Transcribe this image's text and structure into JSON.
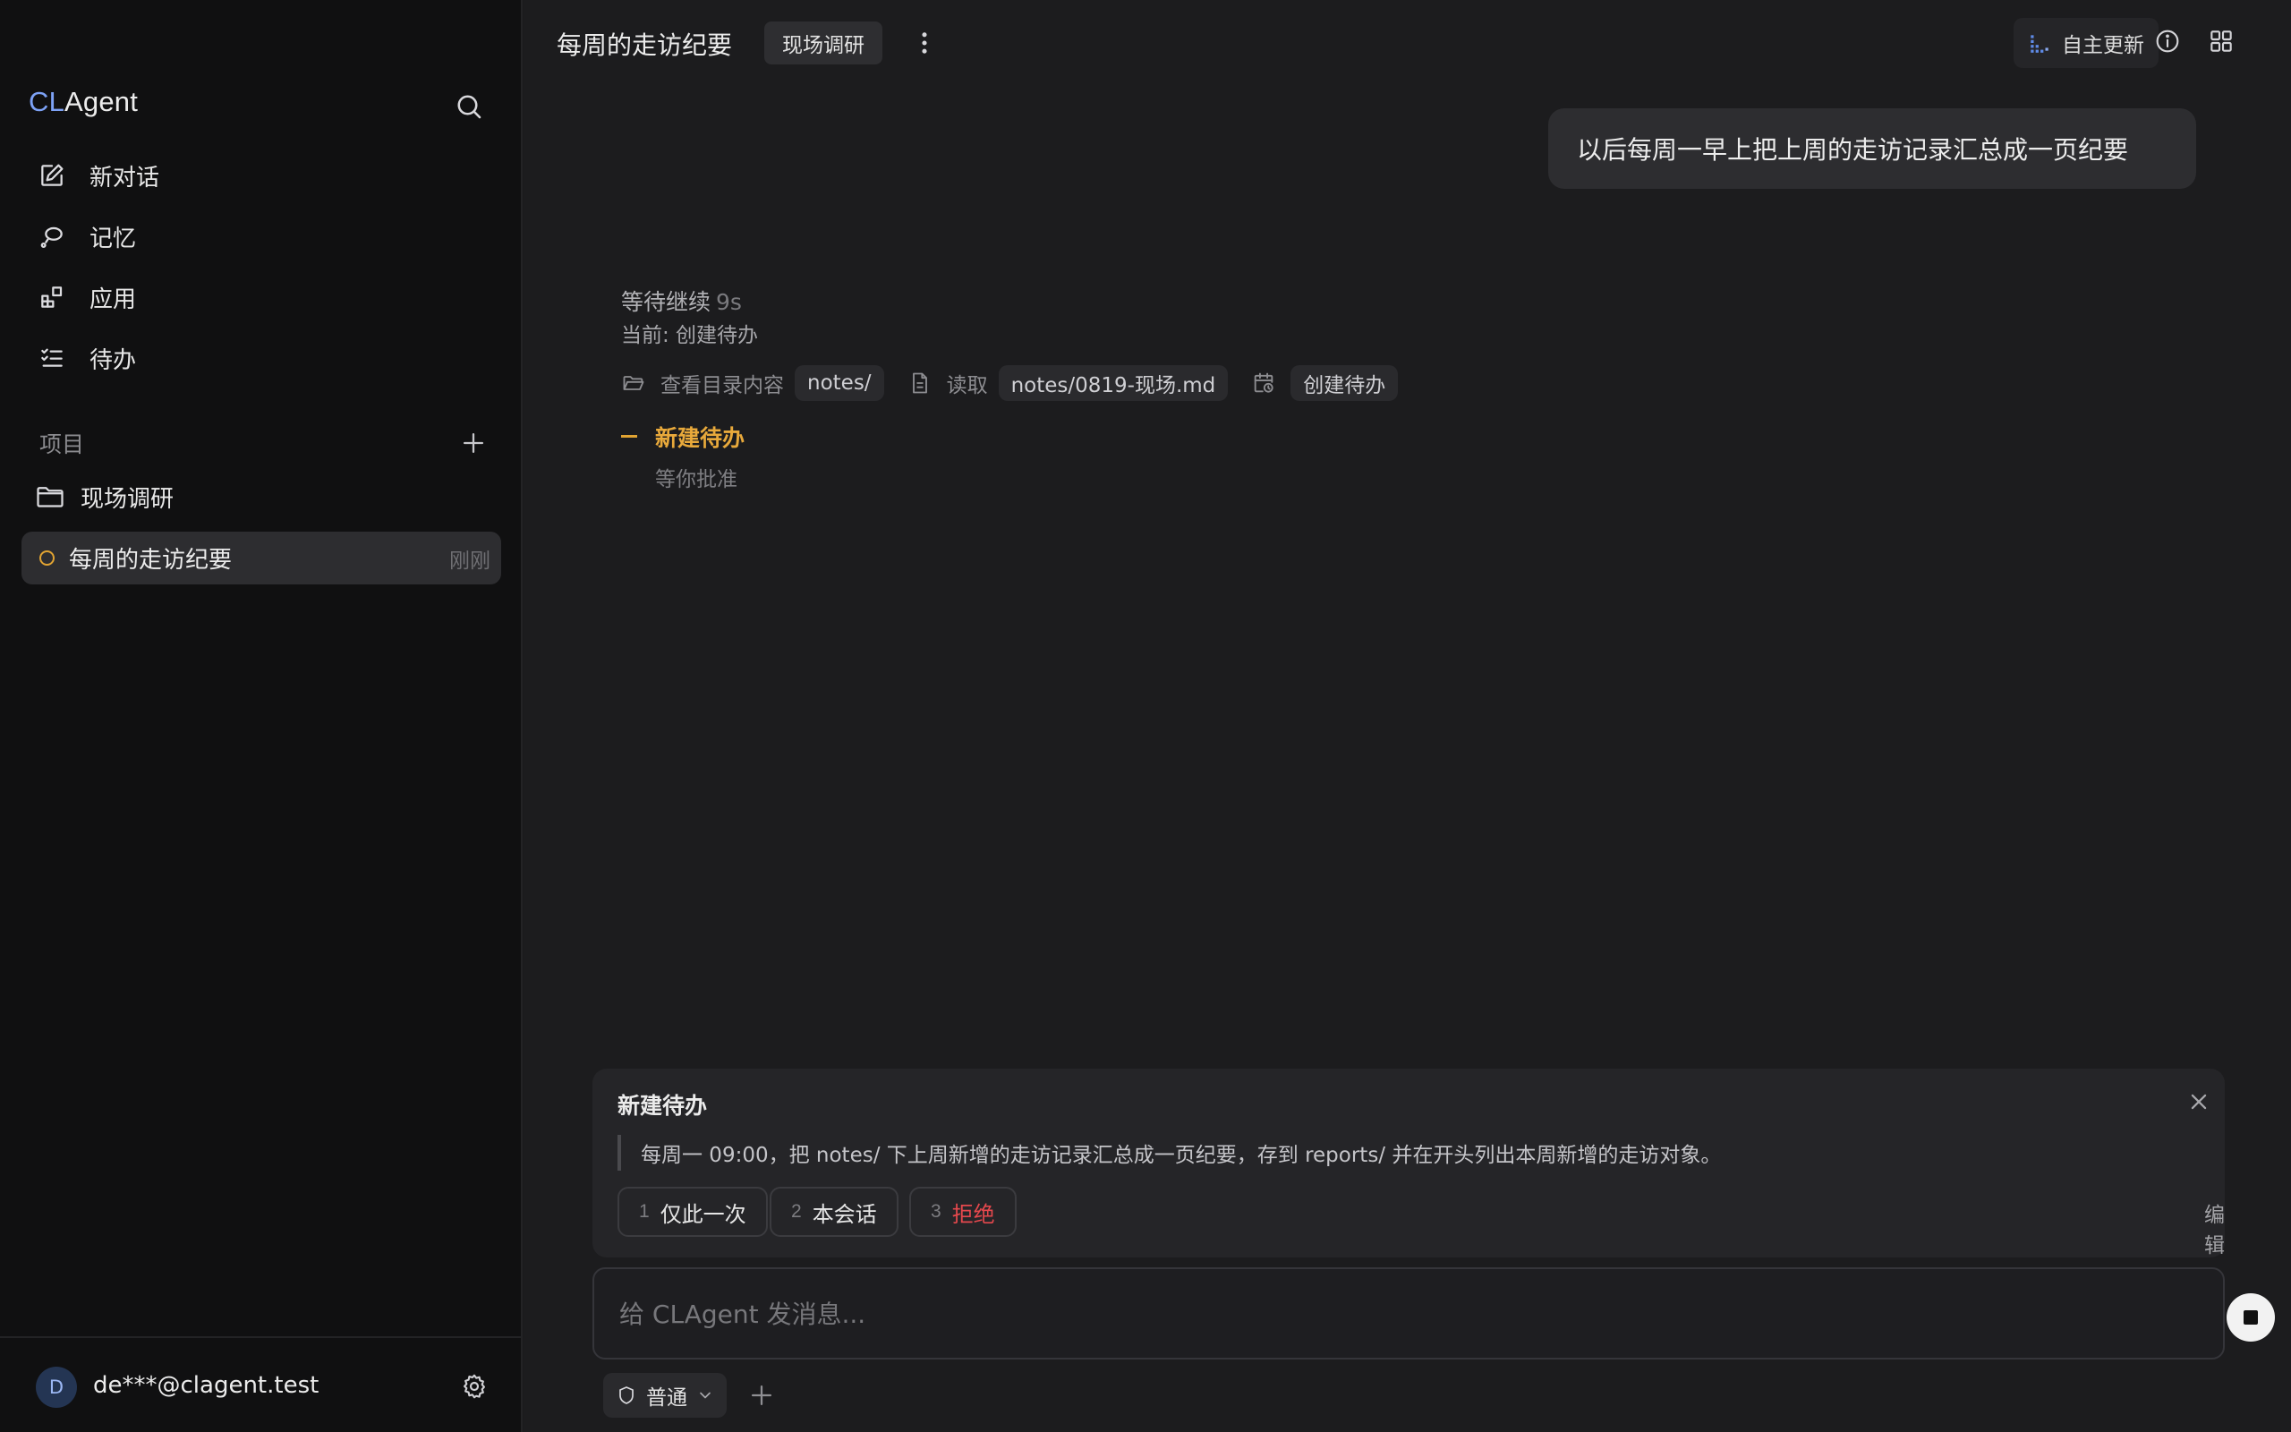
{
  "sidebar": {
    "brand": {
      "prefix": "CL",
      "suffix": "Agent"
    },
    "nav": [
      {
        "label": "新对话",
        "icon": "edit-icon"
      },
      {
        "label": "记忆",
        "icon": "memory-icon"
      },
      {
        "label": "应用",
        "icon": "apps-icon"
      },
      {
        "label": "待办",
        "icon": "todo-list-icon"
      }
    ],
    "projects_label": "项目",
    "project": {
      "name": "现场调研"
    },
    "chat": {
      "title": "每周的走访纪要",
      "time": "刚刚"
    },
    "user": {
      "initial": "D",
      "email": "de***@clagent.test"
    }
  },
  "header": {
    "title": "每周的走访纪要",
    "tag": "现场调研",
    "auto_update": "自主更新"
  },
  "conversation": {
    "user_message": "以后每周一早上把上周的走访记录汇总成一页纪要",
    "status": "等待继续",
    "elapsed": "9s",
    "current": "当前: 创建待办",
    "steps": [
      {
        "label": "查看目录内容",
        "chip": "notes/"
      },
      {
        "label": "读取",
        "chip": "notes/0819-现场.md"
      },
      {
        "label": "",
        "chip": "创建待办"
      }
    ],
    "pending": {
      "title": "新建待办",
      "subtitle": "等你批准"
    }
  },
  "approval": {
    "title": "新建待办",
    "content": "每周一 09:00，把 notes/ 下上周新增的走访记录汇总成一页纪要，存到 reports/ 并在开头列出本周新增的走访对象。",
    "options": [
      {
        "num": "1",
        "label": "仅此一次"
      },
      {
        "num": "2",
        "label": "本会话"
      },
      {
        "num": "3",
        "label": "拒绝"
      }
    ],
    "edit": "编辑"
  },
  "composer": {
    "placeholder": "给 CLAgent 发消息...",
    "mode": "普通"
  },
  "colors": {
    "accent_blue": "#7da2f6",
    "pending_orange": "#e0a332",
    "reject_red": "#e5484d"
  }
}
